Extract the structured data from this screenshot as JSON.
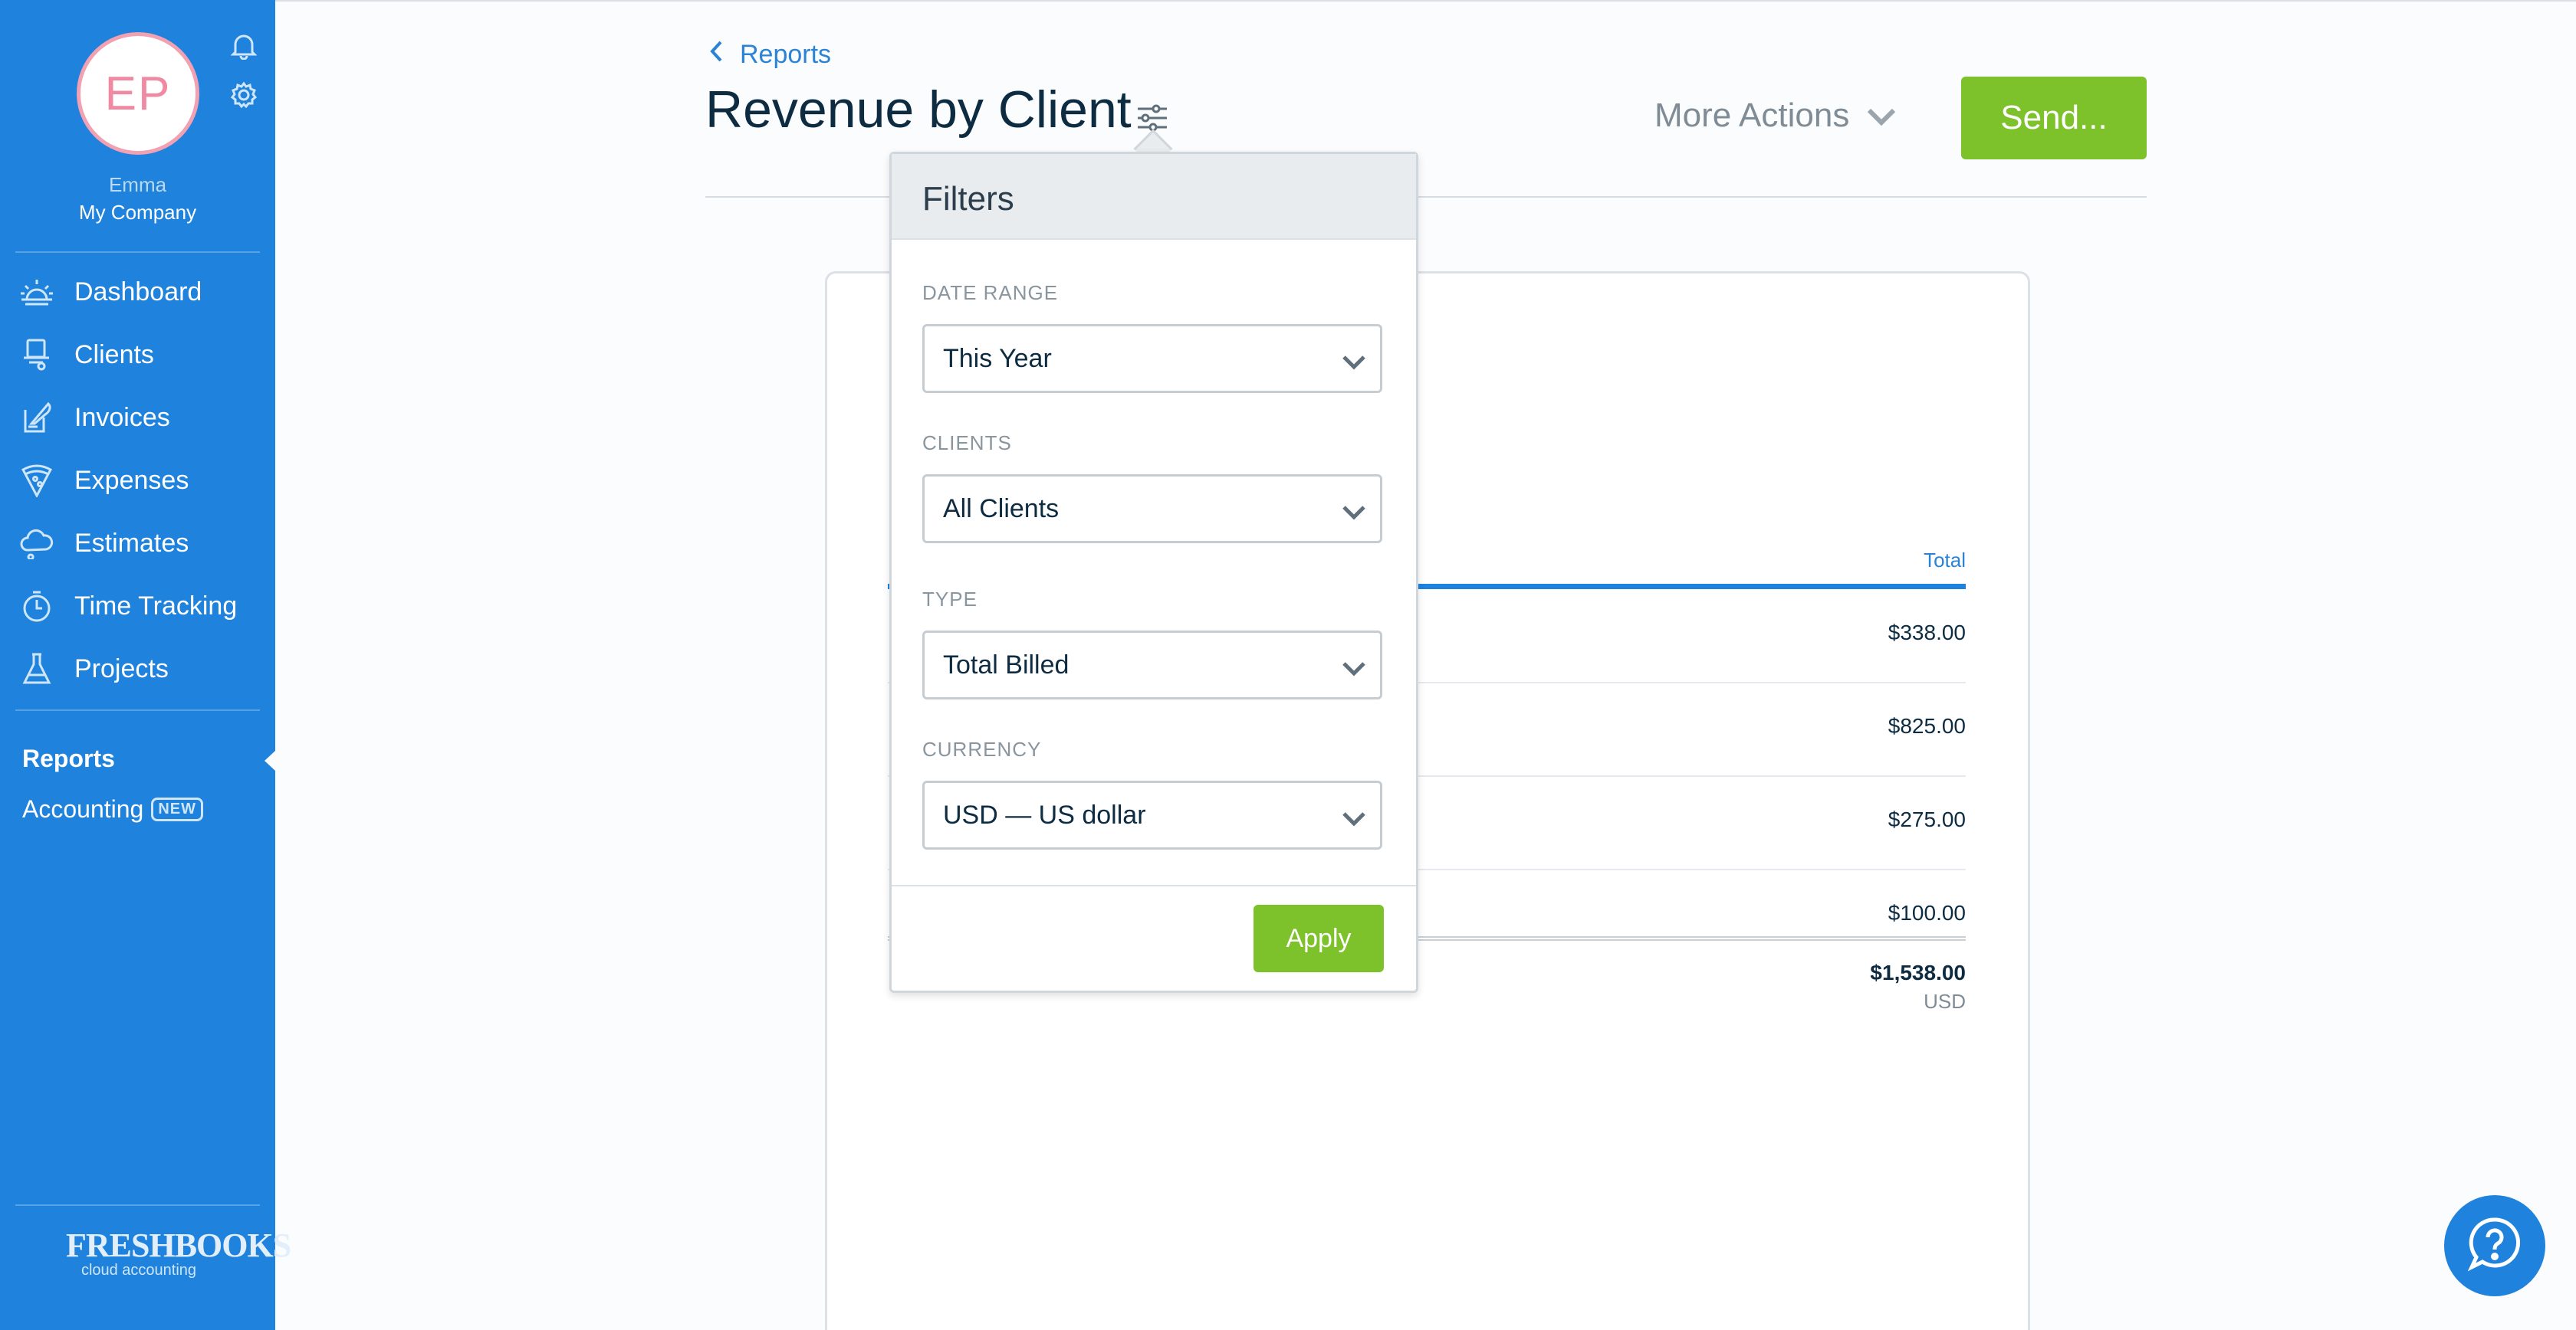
{
  "user": {
    "initials": "EP",
    "name": "Emma",
    "company": "My Company"
  },
  "nav": {
    "items": [
      {
        "label": "Dashboard",
        "icon": "sunrise-icon"
      },
      {
        "label": "Clients",
        "icon": "hat-icon"
      },
      {
        "label": "Invoices",
        "icon": "quill-icon"
      },
      {
        "label": "Expenses",
        "icon": "pizza-icon"
      },
      {
        "label": "Estimates",
        "icon": "cloud-icon"
      },
      {
        "label": "Time Tracking",
        "icon": "stopwatch-icon"
      },
      {
        "label": "Projects",
        "icon": "flask-icon"
      }
    ],
    "reports": "Reports",
    "accounting": "Accounting",
    "accounting_badge": "NEW"
  },
  "brand": {
    "name": "FRESHBOOKS",
    "tagline": "cloud accounting"
  },
  "header": {
    "back_label": "Reports",
    "title": "Revenue by Client",
    "more_actions": "More Actions",
    "send": "Send..."
  },
  "report": {
    "column_total": "Total",
    "rows": [
      "$338.00",
      "$825.00",
      "$275.00",
      "$100.00"
    ],
    "grand_total": "$1,538.00",
    "currency": "USD"
  },
  "filters": {
    "title": "Filters",
    "date_range": {
      "label": "DATE RANGE",
      "value": "This Year"
    },
    "clients": {
      "label": "CLIENTS",
      "value": "All Clients"
    },
    "type": {
      "label": "TYPE",
      "value": "Total Billed"
    },
    "currency": {
      "label": "CURRENCY",
      "value": "USD — US dollar"
    },
    "apply": "Apply"
  },
  "colors": {
    "sidebar": "#1f82dc",
    "accent_green": "#7dc12b",
    "avatar_pink": "#f08aa2",
    "link_blue": "#2a83d4"
  }
}
